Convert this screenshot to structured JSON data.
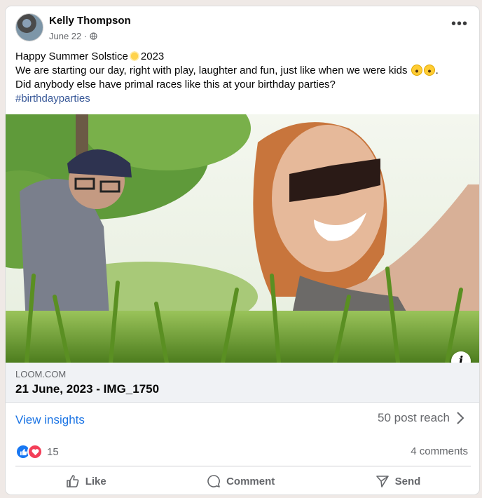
{
  "post": {
    "author": "Kelly Thompson",
    "date": "June 22 ·",
    "text_line1_a": "Happy Summer Solstice",
    "text_line1_b": "2023",
    "text_line2": "We are starting our day, right with play, laughter  and fun, just like when we were kids",
    "text_line2_end": ".",
    "text_line3": "Did anybody else have primal races like this at your birthday parties?",
    "hashtag": "#birthdayparties",
    "icons": {
      "menu": "more-options-icon",
      "privacy": "globe-icon",
      "emoji_sun": "sun-emoji",
      "emoji_grin": "grinning-face-emoji",
      "info": "info-icon"
    }
  },
  "link_preview": {
    "domain": "LOOM.COM",
    "title": "21 June, 2023 - IMG_1750"
  },
  "insights": {
    "label": "View insights",
    "reach": "50 post reach"
  },
  "engagement": {
    "reaction_count": "15",
    "comments": "4 comments",
    "reaction_colors": {
      "like": "#1877f2",
      "love": "#f33e58"
    }
  },
  "actions": {
    "like": "Like",
    "comment": "Comment",
    "send": "Send"
  }
}
